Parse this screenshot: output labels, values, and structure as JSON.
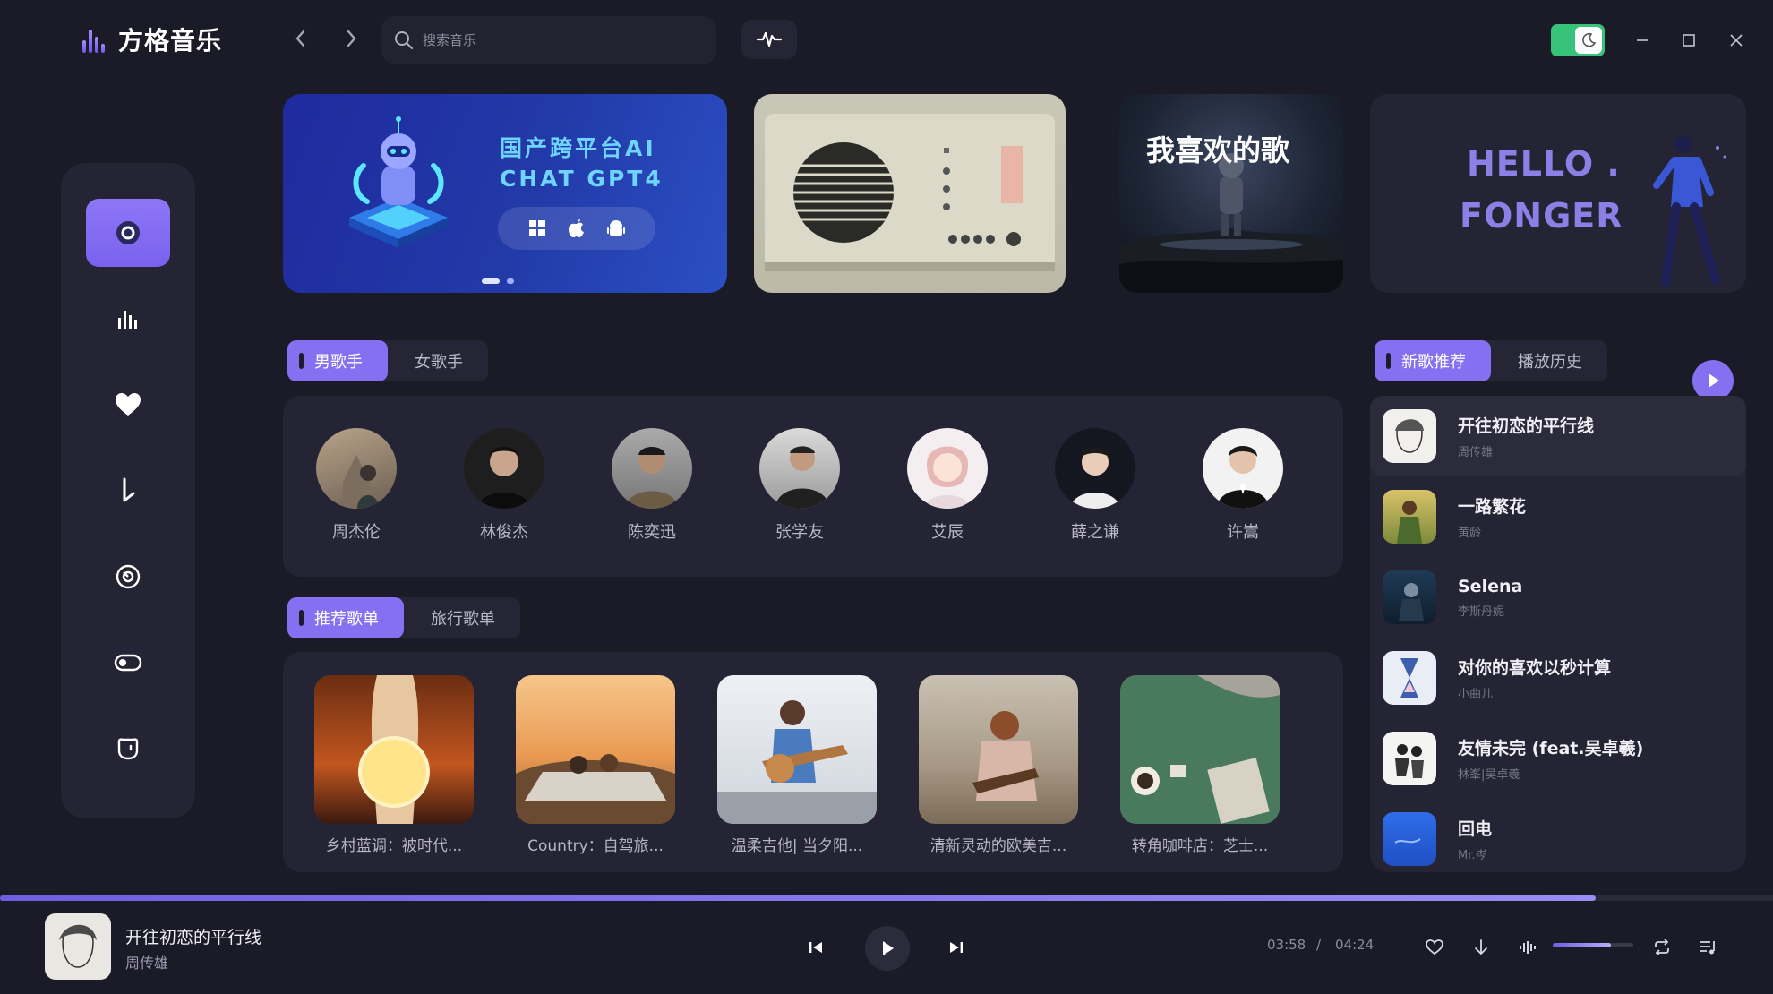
{
  "app": {
    "title": "方格音乐"
  },
  "search": {
    "placeholder": "搜索音乐"
  },
  "sidebar": {
    "items": [
      {
        "icon": "disc-icon",
        "active": true
      },
      {
        "icon": "chart-bars-icon"
      },
      {
        "icon": "heart-icon"
      },
      {
        "icon": "download-icon"
      },
      {
        "icon": "record-icon"
      },
      {
        "icon": "toggle-icon"
      },
      {
        "icon": "face-icon"
      }
    ]
  },
  "banners": {
    "b1_line1": "国产跨平台AI",
    "b1_line2": "CHAT GPT4",
    "b3_title": "我喜欢的歌",
    "b4_line1": "HELLO .",
    "b4_line2": "FONGER"
  },
  "singer_tabs": [
    "男歌手",
    "女歌手"
  ],
  "singers": [
    "周杰伦",
    "林俊杰",
    "陈奕迅",
    "张学友",
    "艾辰",
    "薛之谦",
    "许嵩"
  ],
  "playlist_tabs": [
    "推荐歌单",
    "旅行歌单"
  ],
  "playlists": [
    "乡村蓝调：被时代...",
    "Country：自驾旅...",
    "温柔吉他| 当夕阳...",
    "清新灵动的欧美吉...",
    "转角咖啡店：芝士..."
  ],
  "list_tabs": [
    "新歌推荐",
    "播放历史"
  ],
  "songs": [
    {
      "title": "开往初恋的平行线",
      "artist": "周传雄"
    },
    {
      "title": "一路繁花",
      "artist": "黄龄"
    },
    {
      "title": "Selena",
      "artist": "李斯丹妮"
    },
    {
      "title": "对你的喜欢以秒计算",
      "artist": "小曲儿"
    },
    {
      "title": "友情未完 (feat.吴卓羲)",
      "artist": "林峯|吴卓羲"
    },
    {
      "title": "回电",
      "artist": "Mr.岑"
    }
  ],
  "player": {
    "title": "开往初恋的平行线",
    "artist": "周传雄",
    "current_time": "03:58",
    "separator": "/",
    "total_time": "04:24",
    "progress": 0.9,
    "volume": 0.72
  },
  "colors": {
    "accent": "#8470f0",
    "background": "#1b1a27",
    "panel": "#252434",
    "toggle": "#37c37a"
  }
}
